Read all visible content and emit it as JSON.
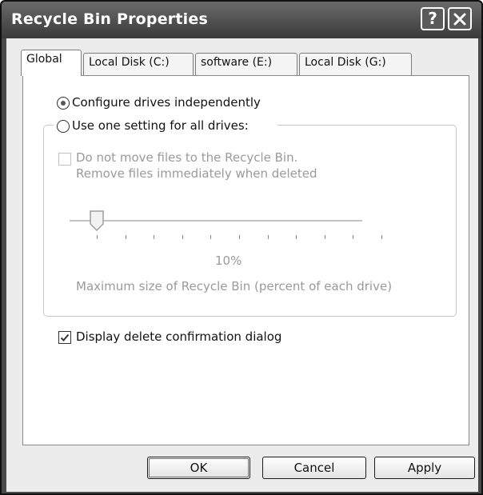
{
  "window": {
    "title": "Recycle Bin Properties",
    "help_icon": "help-icon",
    "close_icon": "close-icon"
  },
  "tabs": [
    {
      "label": "Global",
      "active": true
    },
    {
      "label": "Local Disk (C:)",
      "active": false
    },
    {
      "label": "software (E:)",
      "active": false
    },
    {
      "label": "Local Disk (G:)",
      "active": false
    }
  ],
  "options": {
    "configure_independently": {
      "label": "Configure drives independently",
      "selected": true
    },
    "use_one_setting": {
      "label": "Use one setting for all drives:",
      "selected": false
    }
  },
  "group": {
    "do_not_move": {
      "label_line1": "Do not move files to the Recycle Bin.",
      "label_line2": "Remove files immediately when deleted",
      "checked": false,
      "enabled": false
    },
    "slider": {
      "value_percent": 10,
      "value_label": "10%",
      "caption": "Maximum size of Recycle Bin (percent of each drive)",
      "tick_count": 11,
      "enabled": false
    }
  },
  "display_confirmation": {
    "label": "Display delete confirmation dialog",
    "checked": true
  },
  "buttons": {
    "ok": "OK",
    "cancel": "Cancel",
    "apply": "Apply"
  }
}
